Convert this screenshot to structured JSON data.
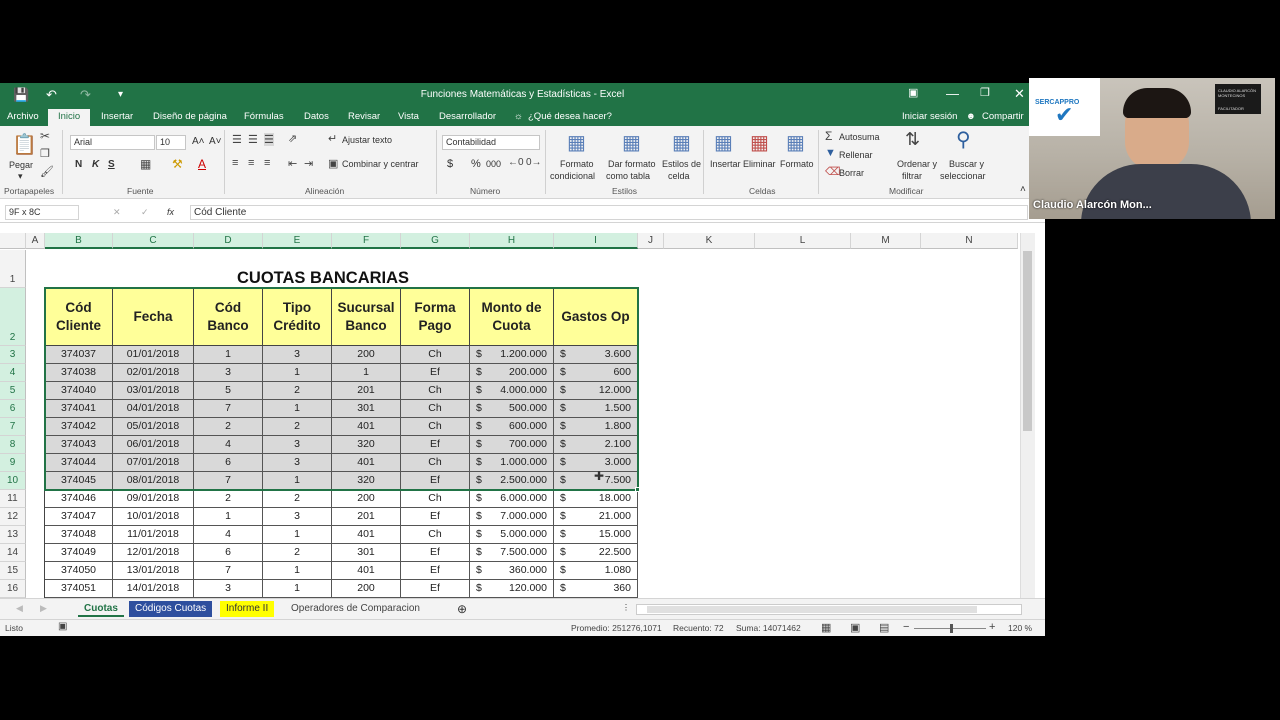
{
  "window": {
    "title": "Funciones Matemáticas y Estadísticas - Excel",
    "colors": {
      "accent": "#217346",
      "header_fill": "#ffff99",
      "selection_fill": "#d9d9d9"
    }
  },
  "tabs": [
    {
      "label": "Archivo"
    },
    {
      "label": "Inicio"
    },
    {
      "label": "Insertar"
    },
    {
      "label": "Diseño de página"
    },
    {
      "label": "Fórmulas"
    },
    {
      "label": "Datos"
    },
    {
      "label": "Revisar"
    },
    {
      "label": "Vista"
    },
    {
      "label": "Desarrollador"
    },
    {
      "label": "¿Qué desea hacer?"
    }
  ],
  "account": {
    "signin": "Iniciar sesión",
    "share": "Compartir"
  },
  "ribbon": {
    "paste": "Pegar",
    "font_name": "Arial",
    "font_size": "10",
    "bold": "N",
    "italic": "K",
    "underline": "S",
    "wrap_text": "Ajustar texto",
    "merge_center": "Combinar y centrar",
    "number_format": "Contabilidad",
    "currency": "$",
    "percent": "%",
    "thousands": "000",
    "cond_format": [
      "Formato",
      "condicional"
    ],
    "format_table": [
      "Dar formato",
      "como tabla"
    ],
    "cell_styles": [
      "Estilos de",
      "celda"
    ],
    "insert": "Insertar",
    "delete": "Eliminar",
    "format": "Formato",
    "autosum": "Autosuma",
    "fill": "Rellenar",
    "clear": "Borrar",
    "sort": [
      "Ordenar y",
      "filtrar"
    ],
    "find": [
      "Buscar y",
      "seleccionar"
    ],
    "groups": [
      "Portapapeles",
      "Fuente",
      "Alineación",
      "Número",
      "Estilos",
      "Celdas",
      "Modificar"
    ]
  },
  "formula_bar": {
    "name_box": "9F x 8C",
    "fx": "fx",
    "content": "Cód Cliente"
  },
  "columns": [
    "A",
    "B",
    "C",
    "D",
    "E",
    "F",
    "G",
    "H",
    "I",
    "J",
    "K",
    "L",
    "M",
    "N"
  ],
  "rows": [
    "1",
    "2",
    "3",
    "4",
    "5",
    "6",
    "7",
    "8",
    "9",
    "10",
    "11",
    "12",
    "13",
    "14",
    "15",
    "16"
  ],
  "sheet_title": "CUOTAS BANCARIAS",
  "headers": [
    "Cód Cliente",
    "Fecha",
    "Cód Banco",
    "Tipo Crédito",
    "Sucursal Banco",
    "Forma Pago",
    "Monto de Cuota",
    "Gastos Op"
  ],
  "table": [
    [
      "374037",
      "01/01/2018",
      "1",
      "3",
      "200",
      "Ch",
      "1.200.000",
      "3.600"
    ],
    [
      "374038",
      "02/01/2018",
      "3",
      "1",
      "1",
      "Ef",
      "200.000",
      "600"
    ],
    [
      "374040",
      "03/01/2018",
      "5",
      "2",
      "201",
      "Ch",
      "4.000.000",
      "12.000"
    ],
    [
      "374041",
      "04/01/2018",
      "7",
      "1",
      "301",
      "Ch",
      "500.000",
      "1.500"
    ],
    [
      "374042",
      "05/01/2018",
      "2",
      "2",
      "401",
      "Ch",
      "600.000",
      "1.800"
    ],
    [
      "374043",
      "06/01/2018",
      "4",
      "3",
      "320",
      "Ef",
      "700.000",
      "2.100"
    ],
    [
      "374044",
      "07/01/2018",
      "6",
      "3",
      "401",
      "Ch",
      "1.000.000",
      "3.000"
    ],
    [
      "374045",
      "08/01/2018",
      "7",
      "1",
      "320",
      "Ef",
      "2.500.000",
      "7.500"
    ],
    [
      "374046",
      "09/01/2018",
      "2",
      "2",
      "200",
      "Ch",
      "6.000.000",
      "18.000"
    ],
    [
      "374047",
      "10/01/2018",
      "1",
      "3",
      "201",
      "Ef",
      "7.000.000",
      "21.000"
    ],
    [
      "374048",
      "11/01/2018",
      "4",
      "1",
      "401",
      "Ch",
      "5.000.000",
      "15.000"
    ],
    [
      "374049",
      "12/01/2018",
      "6",
      "2",
      "301",
      "Ef",
      "7.500.000",
      "22.500"
    ],
    [
      "374050",
      "13/01/2018",
      "7",
      "1",
      "401",
      "Ef",
      "360.000",
      "1.080"
    ],
    [
      "374051",
      "14/01/2018",
      "3",
      "1",
      "200",
      "Ef",
      "120.000",
      "360"
    ]
  ],
  "currency_symbol": "$",
  "selected_rows": 8,
  "sheets": [
    {
      "label": "Cuotas",
      "color": "#f3f3f3",
      "text": "#217346"
    },
    {
      "label": "Códigos Cuotas",
      "color": "#2e4f9e",
      "text": "#ffffff"
    },
    {
      "label": "Informe II",
      "color": "#ffff00",
      "text": "#333333"
    },
    {
      "label": "Operadores de Comparacion",
      "color": "#f3f3f3",
      "text": "#444444"
    }
  ],
  "status": {
    "ready": "Listo",
    "average": "Promedio: 251276,1071",
    "count": "Recuento: 72",
    "sum": "Suma: 14071462",
    "zoom": "120 %"
  },
  "webcam": {
    "name": "Claudio Alarcón Mon...",
    "logo": "SERCAPPRO",
    "banner": "CLAUDIO ALARCÓN MONTECINOS",
    "banner_role": "FACILITADOR"
  }
}
